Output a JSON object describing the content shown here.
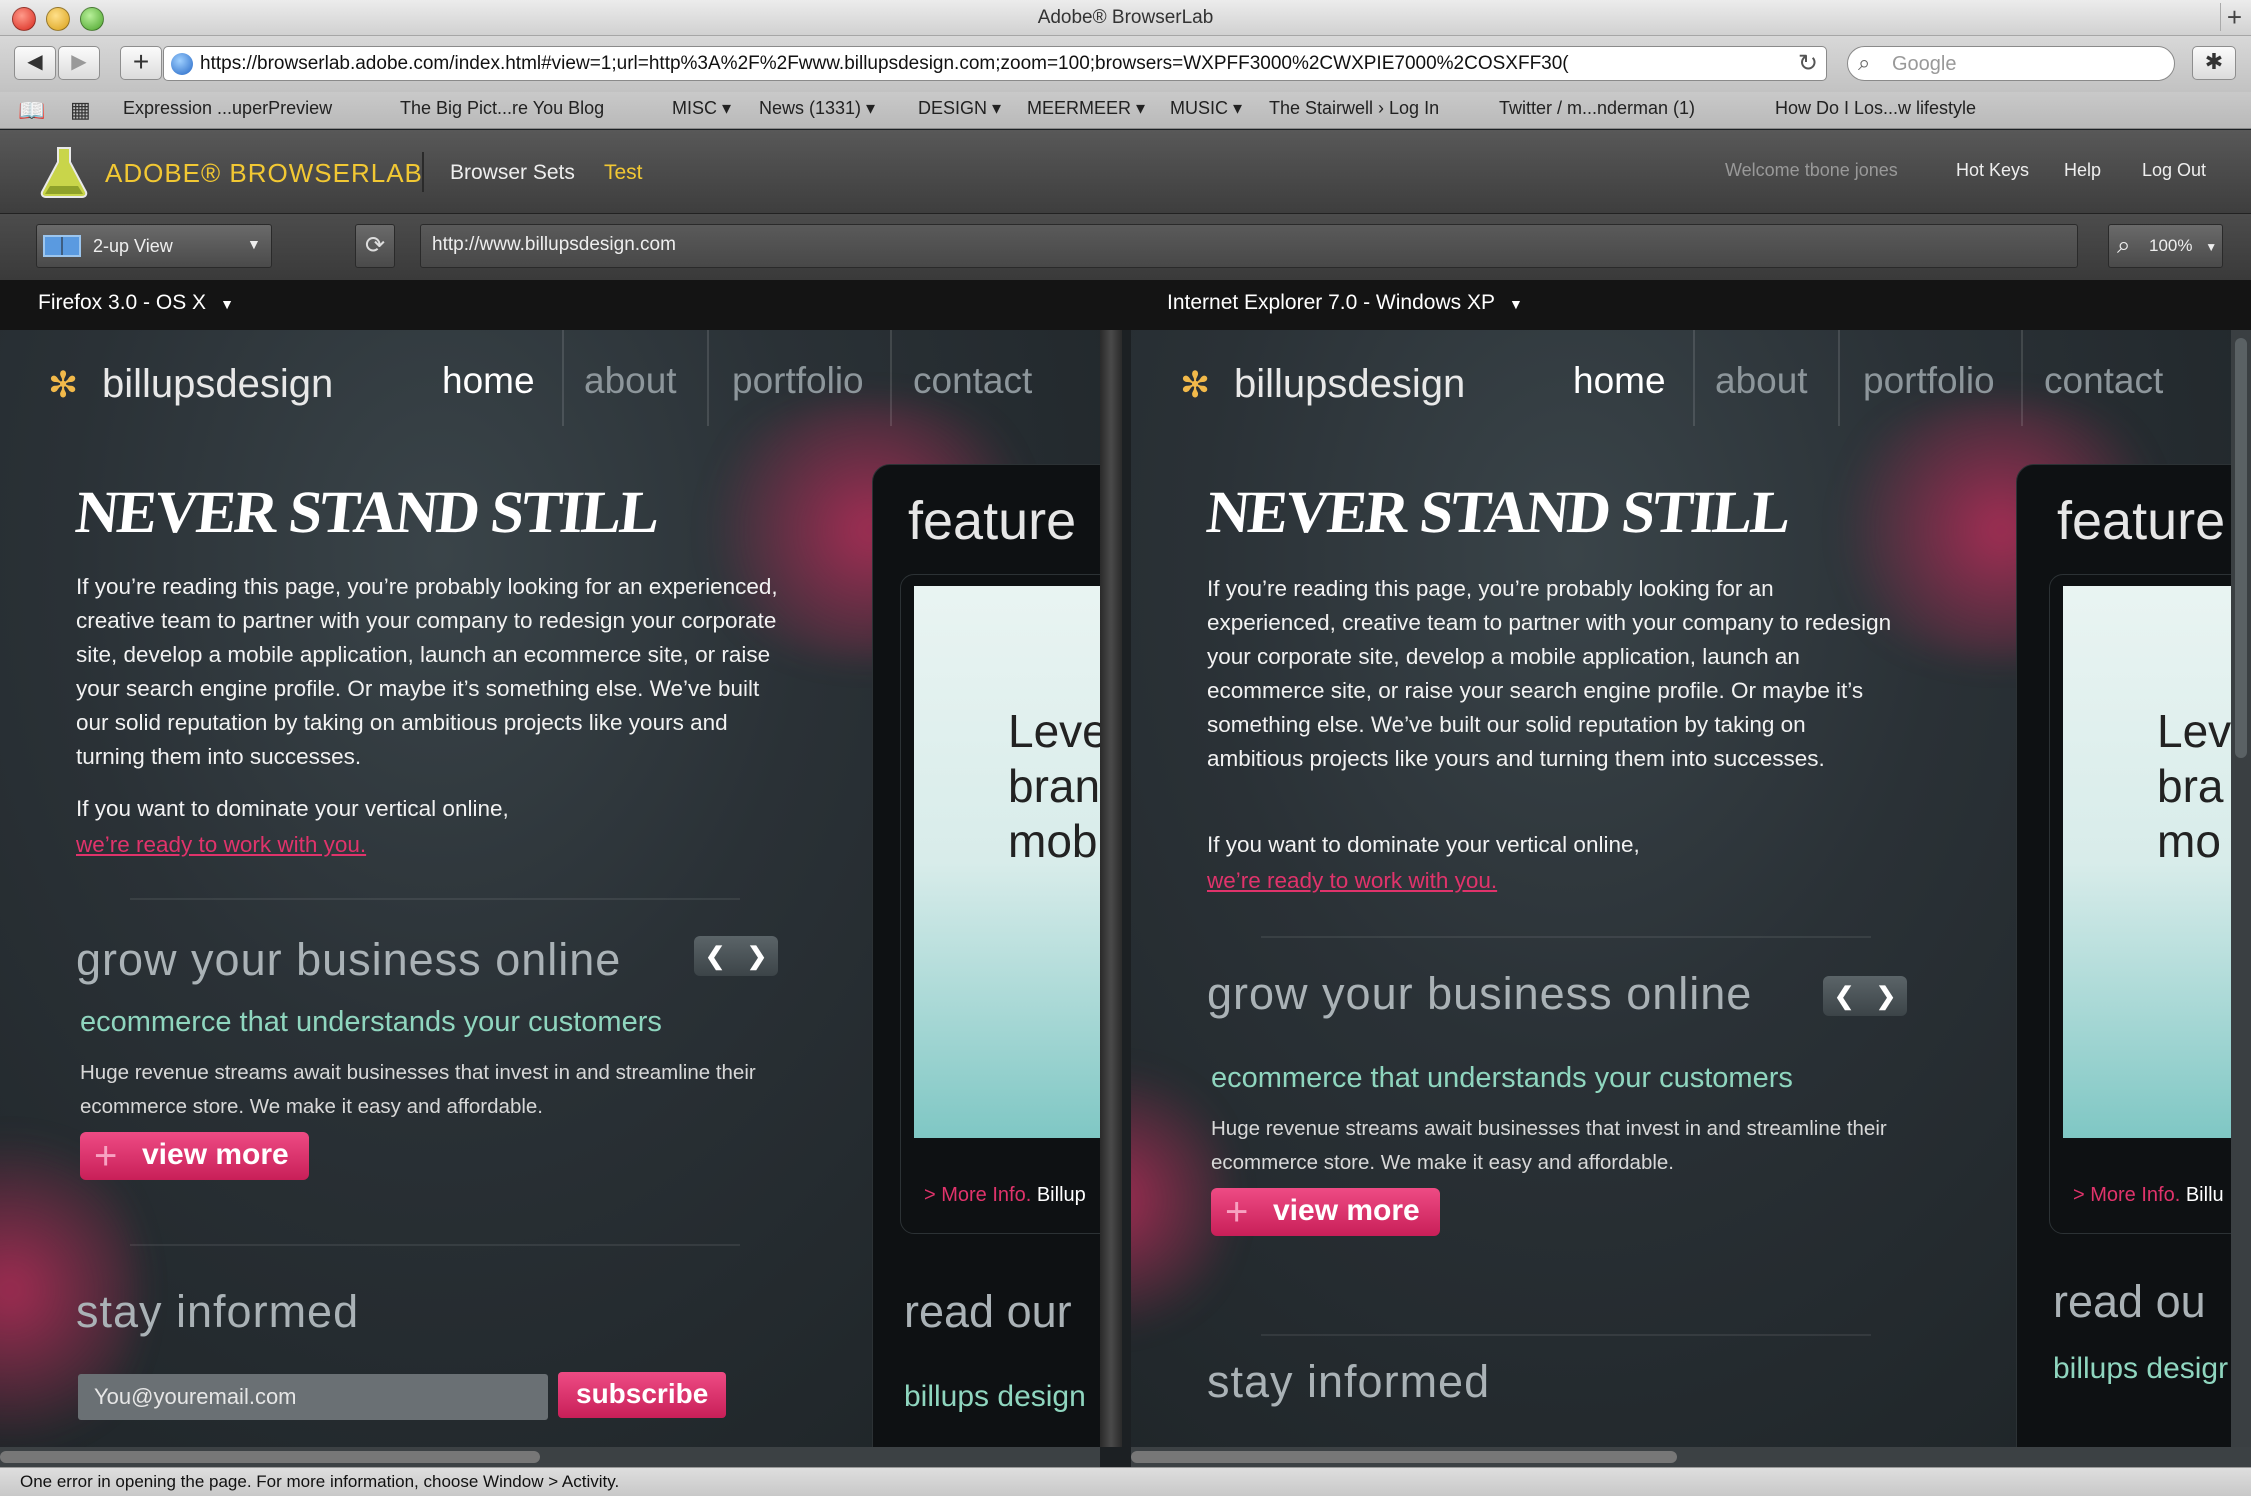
{
  "window": {
    "title": "Adobe® BrowserLab"
  },
  "toolbar": {
    "url": "https://browserlab.adobe.com/index.html#view=1;url=http%3A%2F%2Fwww.billupsdesign.com;zoom=100;browsers=WXPFF3000%2CWXPIE7000%2COSXFF30(",
    "search_placeholder": "Google"
  },
  "bookmarks": [
    "Expression ...uperPreview",
    "The Big Pict...re You Blog",
    "MISC ▾",
    "News (1331) ▾",
    "DESIGN ▾",
    "MEERMEER ▾",
    "MUSIC ▾",
    "The Stairwell › Log In",
    "Twitter / m...nderman (1)",
    "How Do I Los...w lifestyle"
  ],
  "app": {
    "brand": "ADOBE® BROWSERLAB",
    "nav": {
      "browser_sets": "Browser Sets",
      "test": "Test"
    },
    "welcome": "Welcome tbone jones",
    "hotkeys": "Hot Keys",
    "help": "Help",
    "logout": "Log Out",
    "view_mode": "2-up View",
    "site_url": "http://www.billupsdesign.com",
    "zoom": "100%"
  },
  "panels": [
    {
      "browser": "Firefox 3.0 - OS X"
    },
    {
      "browser": "Internet Explorer 7.0 - Windows XP"
    }
  ],
  "site": {
    "logo": "billupsdesign",
    "nav": [
      "home",
      "about",
      "portfolio",
      "contact"
    ],
    "headline": "NEVER STAND STILL",
    "intro": "If you’re reading this page, you’re probably looking for an experienced, creative team to partner with your company to redesign your corporate site, develop a mobile application, launch an ecommerce site, or raise your search engine profile. Or maybe it’s something else. We’ve built our solid reputation by taking on ambitious projects like yours and turning them into successes.",
    "dominate": "If you want to dominate your vertical online,",
    "cta": "we’re ready to work with you.",
    "grow_title": "grow your business online",
    "grow_sub": "ecommerce that understands your customers",
    "grow_text": "Huge revenue streams await businesses that invest in and streamline their ecommerce store. We make it easy and affordable.",
    "view_more": "view more",
    "stay_title": "stay informed",
    "email_placeholder": "You@youremail.com",
    "subscribe": "subscribe",
    "featured_title_a": "feature",
    "featured_title_b": "feature",
    "featured_text_a": "Leve\nbran\nmob",
    "featured_text_b": "Lev\nbra\nmo",
    "more_info": "> More Info.",
    "more_info_name_a": "Billup",
    "more_info_name_b": "Billu",
    "read_our_a": "read our",
    "read_our_b": "read ou",
    "billups_design_a": "billups design",
    "billups_design_b": "billups desigr"
  },
  "status": {
    "text": "One error in opening the page. For more information, choose Window > Activity."
  }
}
